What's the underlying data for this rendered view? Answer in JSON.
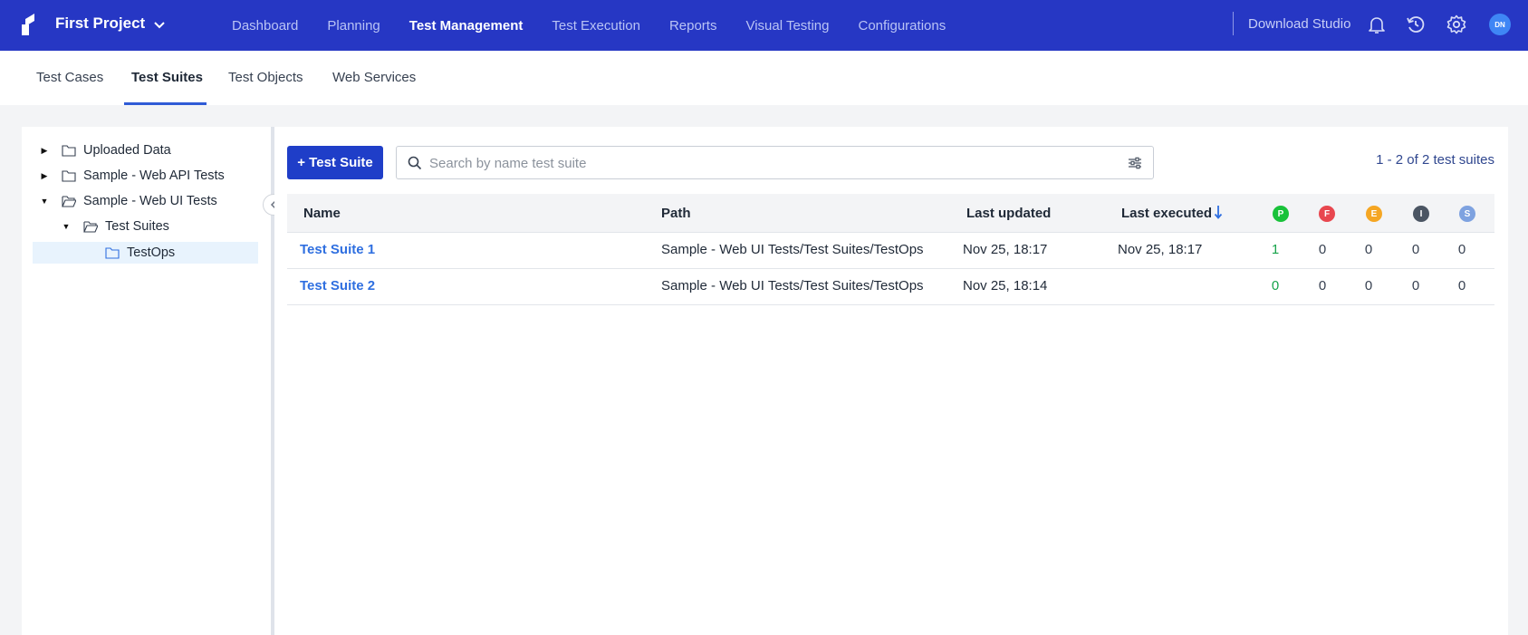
{
  "header": {
    "project_name": "First Project",
    "nav": [
      {
        "label": "Dashboard",
        "active": false
      },
      {
        "label": "Planning",
        "active": false
      },
      {
        "label": "Test Management",
        "active": true
      },
      {
        "label": "Test Execution",
        "active": false
      },
      {
        "label": "Reports",
        "active": false
      },
      {
        "label": "Visual Testing",
        "active": false
      },
      {
        "label": "Configurations",
        "active": false
      }
    ],
    "download_studio": "Download Studio",
    "avatar_initials": "DN",
    "icons": [
      "bell-icon",
      "history-icon",
      "gear-icon"
    ],
    "colors": {
      "bar": "#2637c4",
      "accent": "#1f3ec8"
    }
  },
  "subnav": {
    "tabs": [
      {
        "label": "Test Cases",
        "active": false
      },
      {
        "label": "Test Suites",
        "active": true
      },
      {
        "label": "Test Objects",
        "active": false
      },
      {
        "label": "Web Services",
        "active": false
      }
    ]
  },
  "tree": {
    "items": [
      {
        "label": "Uploaded Data",
        "level": 0,
        "expanded": false
      },
      {
        "label": "Sample - Web API Tests",
        "level": 0,
        "expanded": false
      },
      {
        "label": "Sample - Web UI Tests",
        "level": 0,
        "expanded": true
      },
      {
        "label": "Test Suites",
        "level": 1,
        "expanded": true
      },
      {
        "label": "TestOps",
        "level": 2,
        "selected": true
      }
    ]
  },
  "toolbar": {
    "add_label": "+ Test Suite",
    "search_placeholder": "Search by name test suite",
    "count_text": "1 - 2 of 2 test suites"
  },
  "table": {
    "headers": {
      "name": "Name",
      "path": "Path",
      "last_updated": "Last updated",
      "last_executed": "Last executed",
      "status": [
        "P",
        "F",
        "E",
        "I",
        "S"
      ]
    },
    "status_colors": [
      "#19c23a",
      "#e8474f",
      "#f5a623",
      "#4b5563",
      "#7ea2e0"
    ],
    "rows": [
      {
        "name": "Test Suite 1",
        "path": "Sample - Web UI Tests/Test Suites/TestOps",
        "last_updated": "Nov 25, 18:17",
        "last_executed": "Nov 25, 18:17",
        "counts": [
          "1",
          "0",
          "0",
          "0",
          "0"
        ]
      },
      {
        "name": "Test Suite 2",
        "path": "Sample - Web UI Tests/Test Suites/TestOps",
        "last_updated": "Nov 25, 18:14",
        "last_executed": "",
        "counts": [
          "0",
          "0",
          "0",
          "0",
          "0"
        ]
      }
    ]
  }
}
